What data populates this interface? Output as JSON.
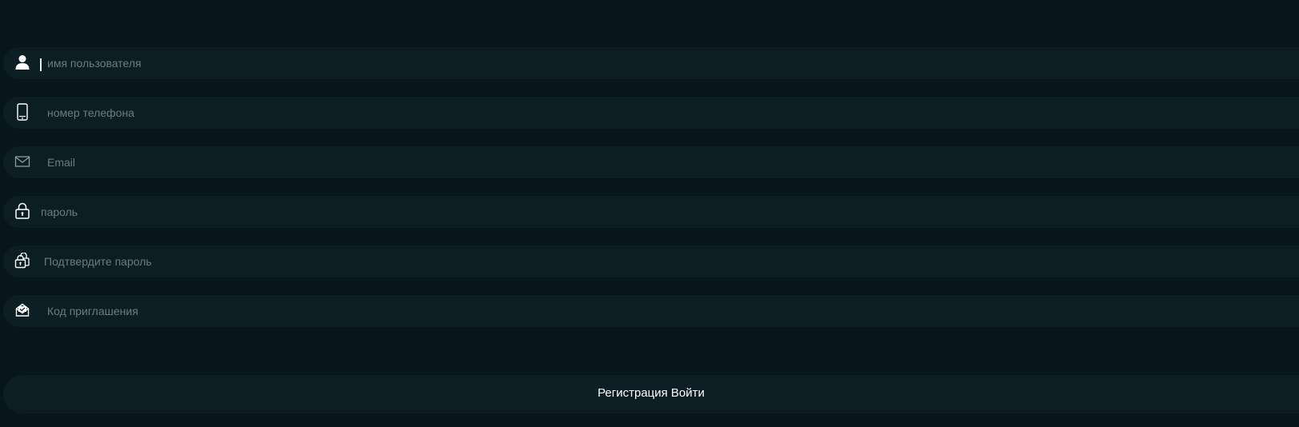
{
  "colors": {
    "background": "#08161b",
    "field_background": "#0c1e23",
    "placeholder": "#6d7b7f",
    "icon": "#ffffff"
  },
  "fields": [
    {
      "name": "username",
      "icon": "user-icon",
      "placeholder": "имя пользователя",
      "value": ""
    },
    {
      "name": "phone",
      "icon": "mobile-phone-icon",
      "placeholder": "номер телефона",
      "value": ""
    },
    {
      "name": "email",
      "icon": "envelope-icon",
      "placeholder": "Email",
      "value": ""
    },
    {
      "name": "password",
      "icon": "lock-icon",
      "placeholder": "пароль",
      "value": ""
    },
    {
      "name": "confirm-password",
      "icon": "double-lock-icon",
      "placeholder": "Подтвердите пароль",
      "value": ""
    },
    {
      "name": "invite-code",
      "icon": "open-envelope-icon",
      "placeholder": "Код приглашения",
      "value": ""
    }
  ],
  "submit": {
    "label": "Регистрация Войти"
  }
}
